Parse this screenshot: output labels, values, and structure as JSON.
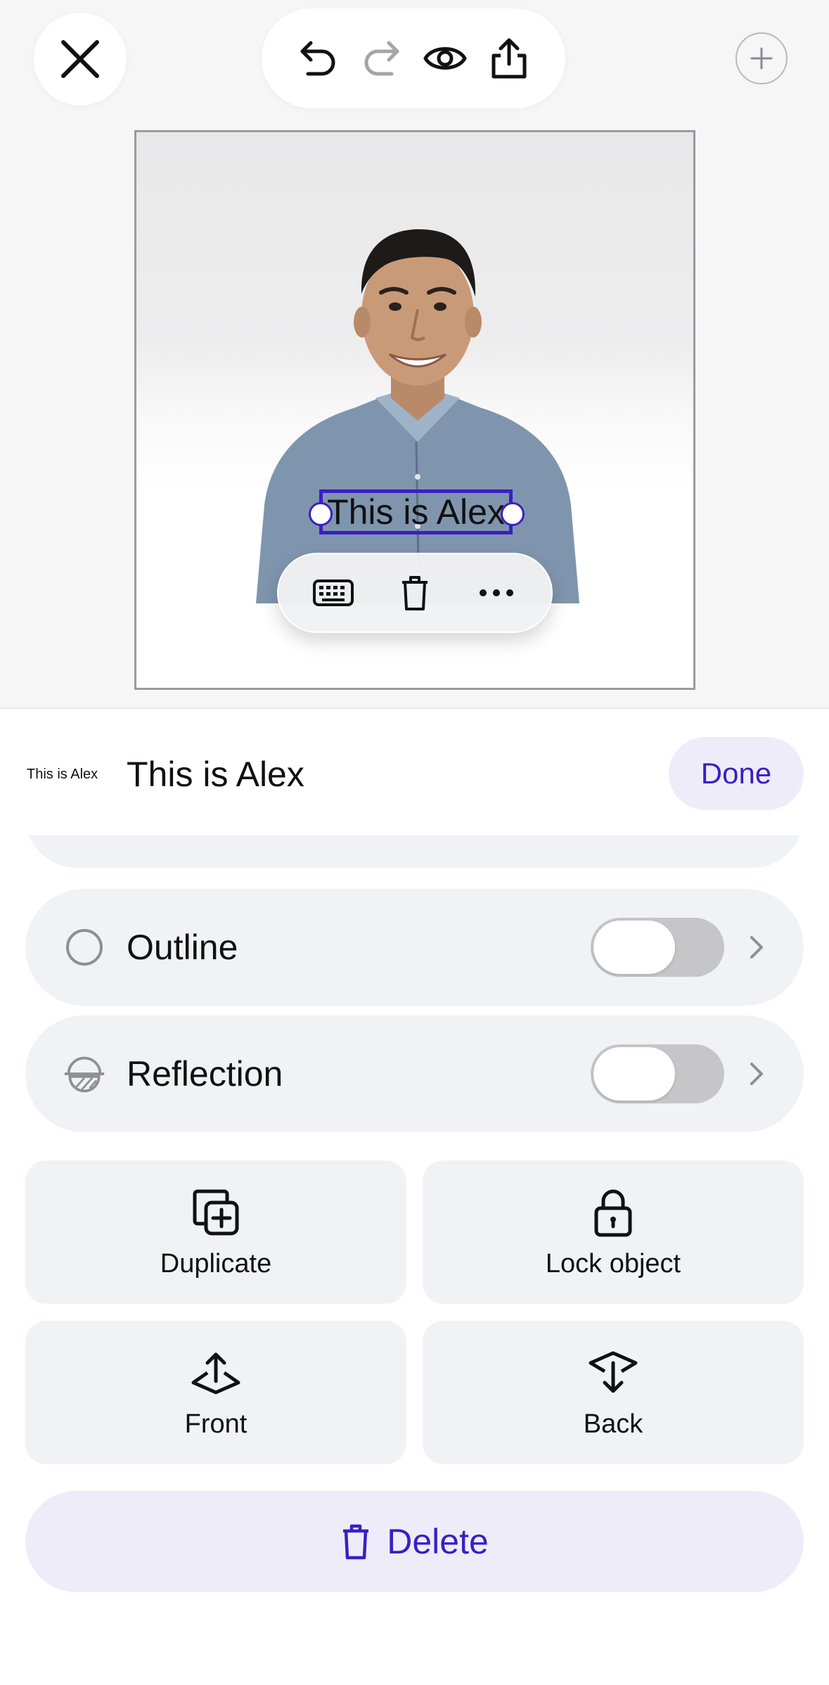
{
  "toolbar": {
    "close_icon": "close-icon",
    "undo_icon": "undo-icon",
    "redo_icon": "redo-icon",
    "preview_icon": "eye-icon",
    "share_icon": "share-icon",
    "add_icon": "plus-icon"
  },
  "canvas": {
    "selected_text": "This is Alex",
    "context_menu": [
      "keyboard-icon",
      "trash-icon",
      "more-icon"
    ]
  },
  "sheet": {
    "thumbnail_text": "This is Alex",
    "title": "This is Alex",
    "done_label": "Done",
    "rows": [
      {
        "label": "Outline",
        "icon": "outline-circle-icon",
        "enabled": false
      },
      {
        "label": "Reflection",
        "icon": "reflection-icon",
        "enabled": false
      }
    ],
    "actions": {
      "duplicate": "Duplicate",
      "lock": "Lock object",
      "front": "Front",
      "back": "Back"
    },
    "delete_label": "Delete"
  },
  "colors": {
    "accent": "#3a1fc4",
    "accent_soft": "#efecf9",
    "row_bg": "#f1f2f5",
    "toggle_off": "#c6c6c9"
  }
}
